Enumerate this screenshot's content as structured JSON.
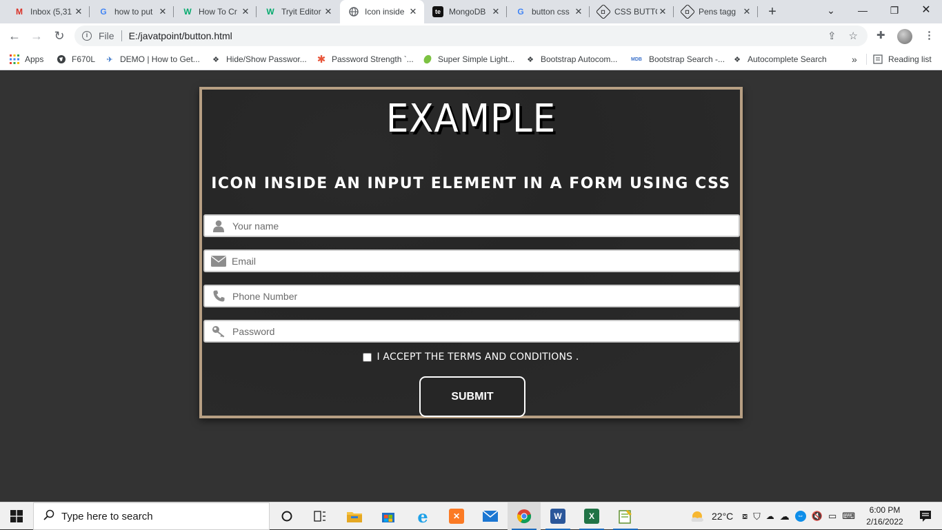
{
  "browser": {
    "tabs": [
      {
        "title": "Inbox (5,31",
        "icon": "gmail-icon",
        "active": false
      },
      {
        "title": "how to put",
        "icon": "google-icon",
        "active": false
      },
      {
        "title": "How To Cr",
        "icon": "w3schools-icon",
        "active": false
      },
      {
        "title": "Tryit Editor",
        "icon": "w3schools-icon",
        "active": false
      },
      {
        "title": "Icon inside",
        "icon": "globe-icon",
        "active": true
      },
      {
        "title": "MongoDB",
        "icon": "te-icon",
        "active": false
      },
      {
        "title": "button css",
        "icon": "google-icon",
        "active": false
      },
      {
        "title": "CSS BUTTO",
        "icon": "codepen-icon",
        "active": false
      },
      {
        "title": "Pens tagg",
        "icon": "codepen-icon",
        "active": false
      }
    ],
    "omnibox": {
      "protocol_label": "File",
      "url": "E:/javatpoint/button.html"
    },
    "bookmarks": [
      {
        "label": "Apps",
        "icon": "apps-grid-icon"
      },
      {
        "label": "F670L",
        "icon": "globe-icon"
      },
      {
        "label": "DEMO | How to Get...",
        "icon": "bird-icon"
      },
      {
        "label": "Hide/Show Passwor...",
        "icon": "codepen-icon"
      },
      {
        "label": "Password Strength `...",
        "icon": "asterisk-icon"
      },
      {
        "label": "Super Simple Light...",
        "icon": "leaf-icon"
      },
      {
        "label": "Bootstrap Autocom...",
        "icon": "codepen-icon"
      },
      {
        "label": "Bootstrap Search -...",
        "icon": "mdb-icon"
      },
      {
        "label": "Autocomplete Search",
        "icon": "codepen-icon"
      }
    ],
    "bookmarks_overflow": "»",
    "reading_list": "Reading list"
  },
  "page": {
    "heading": "EXAMPLE",
    "subheading": "ICON INSIDE AN INPUT ELEMENT IN A FORM USING CSS",
    "fields": [
      {
        "placeholder": "Your name",
        "icon": "user-icon"
      },
      {
        "placeholder": "Email",
        "icon": "envelope-icon"
      },
      {
        "placeholder": "Phone Number",
        "icon": "phone-icon"
      },
      {
        "placeholder": "Password",
        "icon": "key-icon"
      }
    ],
    "terms_label": "I ACCEPT THE TERMS AND CONDITIONS .",
    "submit_label": "SUBMIT",
    "accent_color": "#b79f83"
  },
  "taskbar": {
    "search_placeholder": "Type here to search",
    "weather": "22°C",
    "time": "6:00 PM",
    "date": "2/16/2022"
  }
}
